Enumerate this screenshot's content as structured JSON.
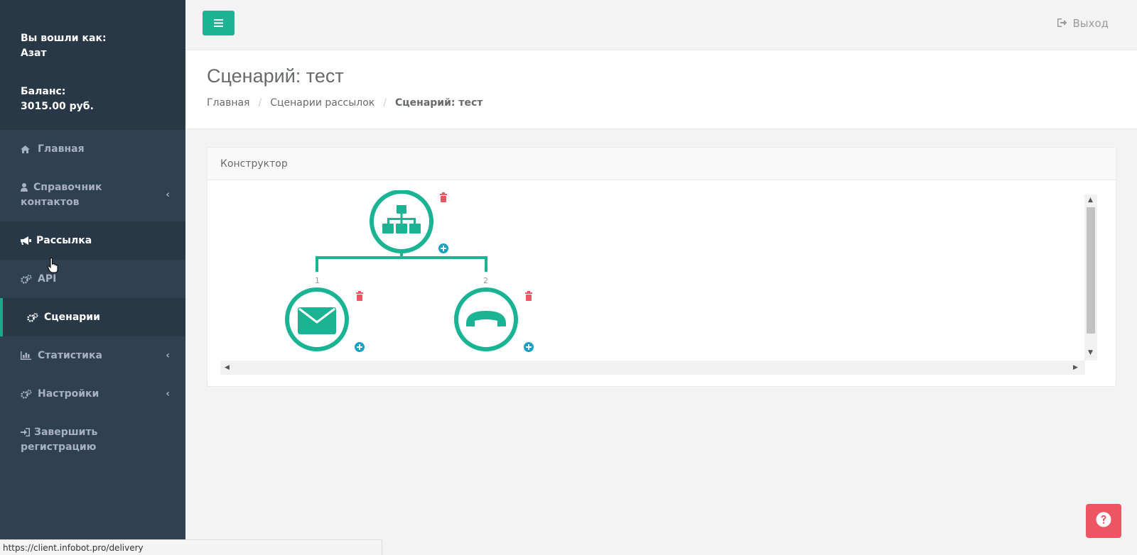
{
  "sidebar": {
    "logged_in_label": "Вы вошли как:",
    "user_name": "Азат",
    "balance_label": "Баланс:",
    "balance_value": "3015.00 руб.",
    "items": [
      {
        "label": "Главная",
        "icon": "home-icon"
      },
      {
        "label_line1": "Справочник",
        "label_line2": "контактов",
        "icon": "user-icon"
      },
      {
        "label": "Рассылка",
        "icon": "megaphone-icon"
      },
      {
        "label": "API",
        "icon": "cogs-icon"
      },
      {
        "label": "Сценарии",
        "icon": "cogs-icon"
      },
      {
        "label": "Статистика",
        "icon": "bar-chart-icon"
      },
      {
        "label": "Настройки",
        "icon": "cogs-icon"
      },
      {
        "label_line1": "Завершить",
        "label_line2": "регистрацию",
        "icon": "sign-in-icon"
      }
    ]
  },
  "topbar": {
    "logout_label": "Выход"
  },
  "page": {
    "title": "Сценарий: тест",
    "breadcrumb": [
      "Главная",
      "Сценарии рассылок",
      "Сценарий: тест"
    ]
  },
  "panel": {
    "title": "Конструктор",
    "branch_labels": [
      "1",
      "2"
    ]
  },
  "status_url": "https://client.infobot.pro/delivery",
  "colors": {
    "accent": "#1ab394",
    "sidebar_bg": "#2f4050",
    "delete_red": "#ed5565"
  }
}
